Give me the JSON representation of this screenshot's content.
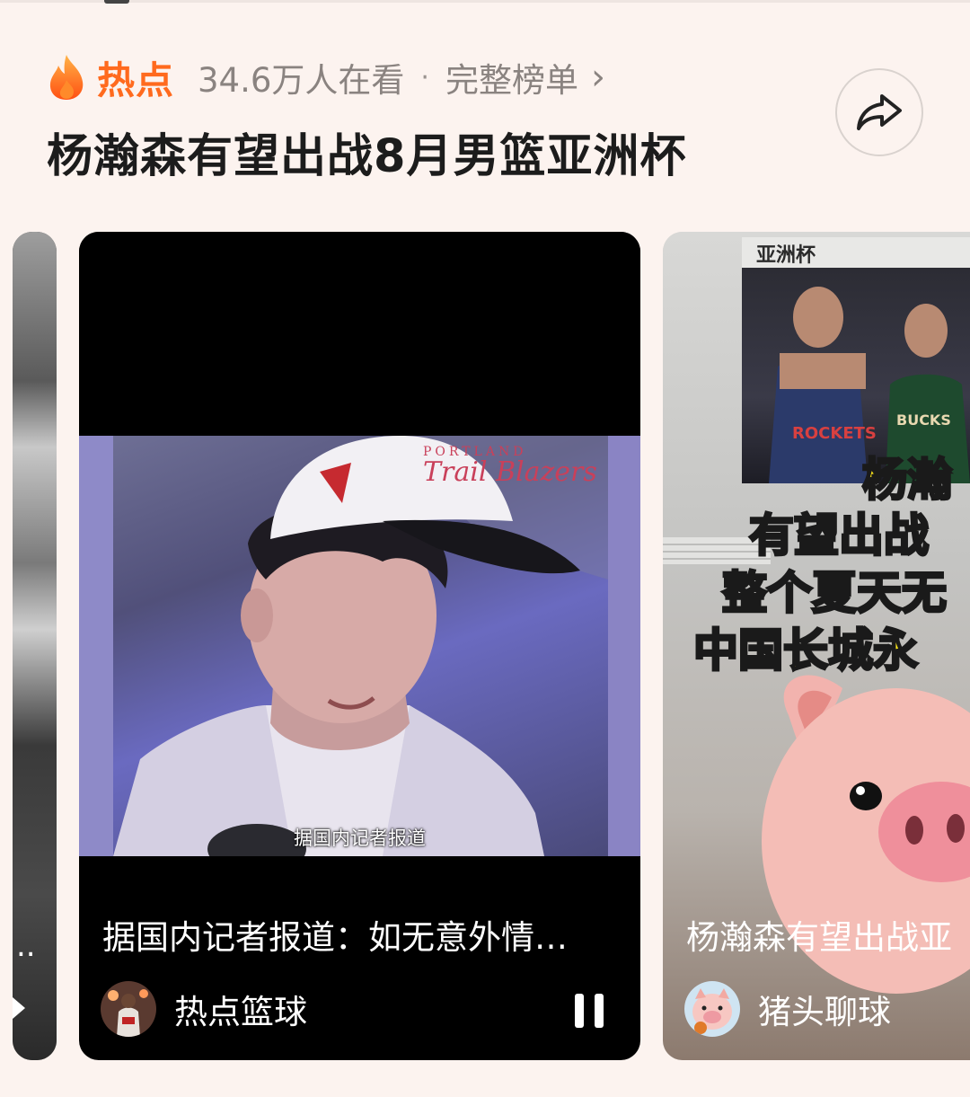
{
  "header": {
    "hot_label": "热点",
    "viewers": "34.6万人在看",
    "separator": "·",
    "full_list": "完整榜单",
    "chevron": "›",
    "title": "杨瀚森有望出战8月男篮亚洲杯"
  },
  "icons": {
    "flame": "flame-icon",
    "share": "share-icon",
    "pause": "pause-icon"
  },
  "colors": {
    "accent": "#ff6a1e",
    "background": "#fcf3ef",
    "overlay_text": "#ffe81a"
  },
  "cards": {
    "left": {
      "caption_fragment": ".."
    },
    "main": {
      "subtitle": "据国内记者报道",
      "caption": "据国内记者报道：如无意外情…",
      "author": "热点篮球",
      "cap_text": "PORTLAND",
      "cap_script": "Trail Blazers"
    },
    "right": {
      "image_label": "亚洲杯",
      "jersey_left": "ROCKETS",
      "jersey_right": "BUCKS",
      "overlay_line1": "杨瀚",
      "overlay_line2": "有望出战",
      "overlay_line3": "整个夏天无",
      "overlay_line4": "中国长城永",
      "caption": "杨瀚森有望出战亚",
      "author": "猪头聊球"
    }
  }
}
